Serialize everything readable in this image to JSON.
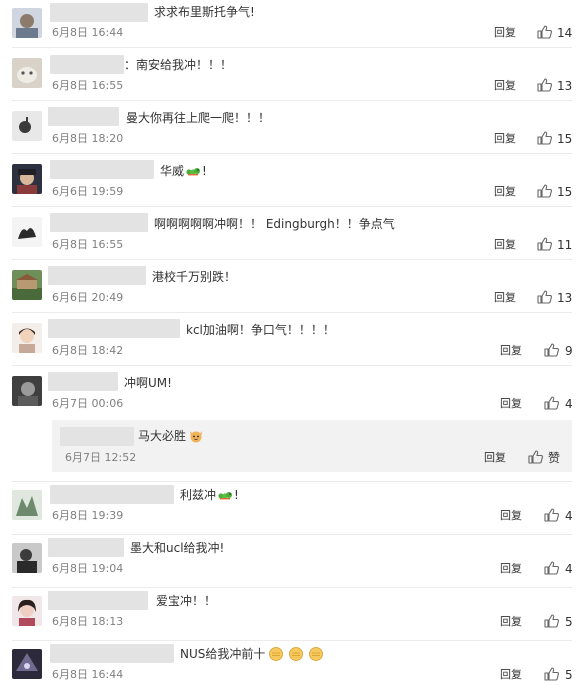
{
  "reply_label": "回复",
  "comments": [
    {
      "text": "求求布里斯托争气!",
      "time": "6月8日 16:44",
      "likes": "14"
    },
    {
      "text": "：南安给我冲！！！",
      "time": "6月8日 16:55",
      "likes": "13"
    },
    {
      "text": "曼大你再往上爬一爬！！！",
      "time": "6月8日 18:20",
      "likes": "15"
    },
    {
      "text": "华威",
      "suffix": "!",
      "time": "6月6日 19:59",
      "likes": "15"
    },
    {
      "text": "啊啊啊啊啊冲啊！！ Edingburgh！！争点气",
      "time": "6月8日 16:55",
      "likes": "11"
    },
    {
      "text": "港校千万别跌！",
      "time": "6月6日 20:49",
      "likes": "13"
    },
    {
      "text": "kcl加油啊！争口气！！！！",
      "time": "6月8日 18:42",
      "likes": "9"
    },
    {
      "text": "冲啊UM!",
      "time": "6月7日 00:06",
      "likes": "4"
    },
    {
      "text": "利兹冲",
      "suffix": "!",
      "time": "6月8日 19:39",
      "likes": "4"
    },
    {
      "text": "墨大和ucl给我冲!",
      "time": "6月8日 19:04",
      "likes": "4"
    },
    {
      "text": "爱宝冲！！",
      "time": "6月8日 18:13",
      "likes": "5"
    },
    {
      "text": "NUS给我冲前十",
      "time": "6月8日 16:44",
      "likes": "5"
    }
  ],
  "sub_reply": {
    "text": "马大必胜",
    "time": "6月7日 12:52",
    "like_label": "赞"
  },
  "colors": {
    "divider": "#ebebeb",
    "blur": "#e3e3e3",
    "subbox": "#f2f2f2",
    "time": "#808080"
  }
}
